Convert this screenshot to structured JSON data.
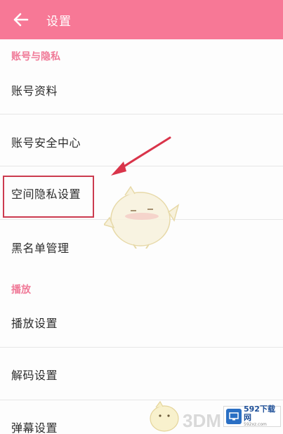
{
  "app_bar": {
    "back_icon": "arrow-left-icon",
    "title": "设置",
    "bg_color": "#f77896"
  },
  "sections": [
    {
      "header": "账号与隐私",
      "items": [
        {
          "label": "账号资料"
        },
        {
          "label": "账号安全中心"
        },
        {
          "label": "空间隐私设置"
        },
        {
          "label": "黑名单管理"
        }
      ]
    },
    {
      "header": "播放",
      "items": [
        {
          "label": "播放设置"
        },
        {
          "label": "解码设置"
        },
        {
          "label": "弹幕设置"
        }
      ]
    }
  ],
  "accent_color": "#f07a98",
  "annotation": {
    "highlight_color": "#cc3b4f",
    "arrow_icon": "pointer-arrow-icon"
  },
  "watermarks": {
    "site_logo_text": "3DM",
    "badge_main": "592下载网",
    "badge_sub": "592xz.com"
  }
}
